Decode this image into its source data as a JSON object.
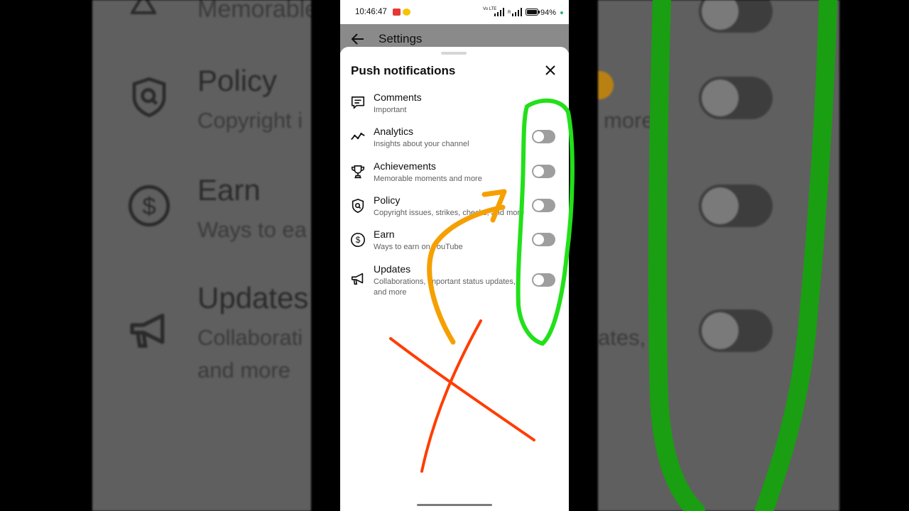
{
  "status": {
    "time": "10:46:47",
    "battery": "94%",
    "network_labels": [
      "Vo LTE",
      "R"
    ]
  },
  "header": {
    "title": "Settings"
  },
  "sheet": {
    "title": "Push notifications",
    "items": [
      {
        "label": "Comments",
        "description": "Important",
        "icon": "comment-icon",
        "toggle": null
      },
      {
        "label": "Analytics",
        "description": "Insights about your channel",
        "icon": "analytics-icon",
        "toggle": false
      },
      {
        "label": "Achievements",
        "description": "Memorable moments and more",
        "icon": "trophy-icon",
        "toggle": false
      },
      {
        "label": "Policy",
        "description": "Copyright issues, strikes, checks, and more",
        "icon": "policy-shield-icon",
        "toggle": false
      },
      {
        "label": "Earn",
        "description": "Ways to earn on YouTube",
        "icon": "dollar-icon",
        "toggle": false
      },
      {
        "label": "Updates",
        "description": "Collaborations, important status updates, and more",
        "icon": "megaphone-icon",
        "toggle": false
      }
    ]
  },
  "background_left": {
    "items": [
      {
        "title": "Memorable"
      },
      {
        "title": "Policy",
        "sub": "Copyright i"
      },
      {
        "title": "Earn",
        "sub": "Ways to ea"
      },
      {
        "title": "Updates",
        "sub": "Collaborati",
        "sub2": "and more"
      }
    ]
  },
  "background_right": {
    "texts": [
      "more",
      "ates,"
    ]
  },
  "colors": {
    "annotation_green": "#22e01a",
    "annotation_orange": "#f5a000",
    "annotation_red": "#ff3d00",
    "toggle_off": "#9e9e9e"
  }
}
